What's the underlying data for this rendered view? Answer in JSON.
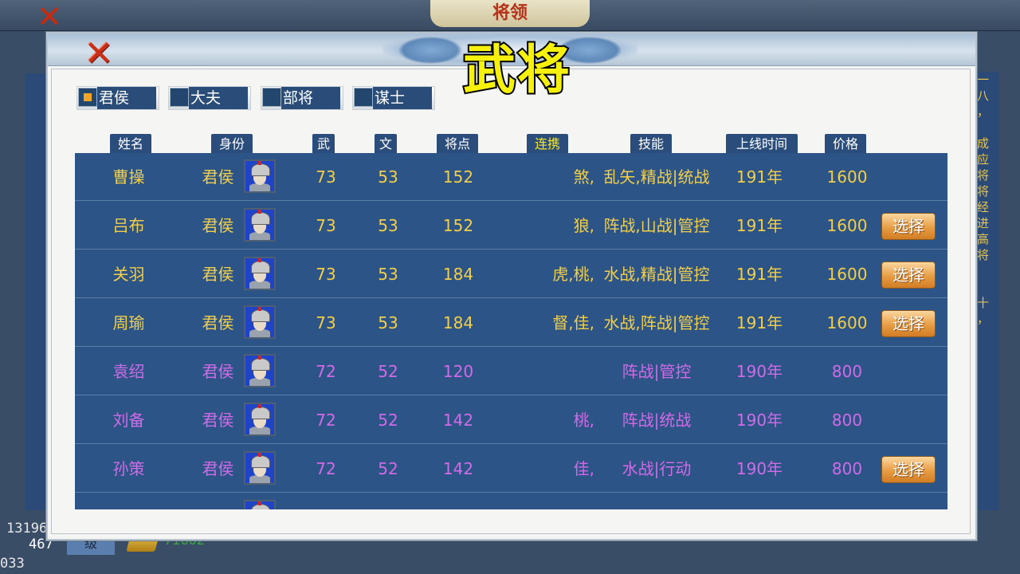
{
  "background": {
    "title": "将领",
    "num1": "13196",
    "num2": "467",
    "num3": "033",
    "level": "级",
    "gold": "71662",
    "right_text": [
      "一",
      "八",
      "，",
      "",
      "成",
      "应",
      "将",
      "将",
      "经",
      "进",
      "高",
      "将",
      "",
      "",
      "十",
      "，"
    ]
  },
  "dialog": {
    "close_glyph": "✕",
    "overlay_title": "武将",
    "filters": [
      {
        "label": "君侯",
        "checked": true
      },
      {
        "label": "大夫",
        "checked": false
      },
      {
        "label": "部将",
        "checked": false
      },
      {
        "label": "谋士",
        "checked": false
      }
    ],
    "columns": {
      "name": "姓名",
      "rank": "身份",
      "wu": "武",
      "wen": "文",
      "points": "将点",
      "combo": "连携",
      "skills": "技能",
      "online": "上线时间",
      "price": "价格"
    },
    "select_label": "选择",
    "rows": [
      {
        "name": "曹操",
        "rank": "君侯",
        "wu": "73",
        "wen": "53",
        "points": "152",
        "combo": "煞,",
        "skills": "乱矢,精战|统战",
        "online": "191年",
        "price": "1600",
        "selectable": false,
        "tier": "gold"
      },
      {
        "name": "吕布",
        "rank": "君侯",
        "wu": "73",
        "wen": "53",
        "points": "152",
        "combo": "狼,",
        "skills": "阵战,山战|管控",
        "online": "191年",
        "price": "1600",
        "selectable": true,
        "tier": "gold"
      },
      {
        "name": "关羽",
        "rank": "君侯",
        "wu": "73",
        "wen": "53",
        "points": "184",
        "combo": "虎,桃,",
        "skills": "水战,精战|管控",
        "online": "191年",
        "price": "1600",
        "selectable": true,
        "tier": "gold"
      },
      {
        "name": "周瑜",
        "rank": "君侯",
        "wu": "73",
        "wen": "53",
        "points": "184",
        "combo": "督,佳,",
        "skills": "水战,阵战|管控",
        "online": "191年",
        "price": "1600",
        "selectable": true,
        "tier": "gold"
      },
      {
        "name": "袁绍",
        "rank": "君侯",
        "wu": "72",
        "wen": "52",
        "points": "120",
        "combo": "",
        "skills": "阵战|管控",
        "online": "190年",
        "price": "800",
        "selectable": false,
        "tier": "purple"
      },
      {
        "name": "刘备",
        "rank": "君侯",
        "wu": "72",
        "wen": "52",
        "points": "142",
        "combo": "桃,",
        "skills": "阵战|统战",
        "online": "190年",
        "price": "800",
        "selectable": false,
        "tier": "purple"
      },
      {
        "name": "孙策",
        "rank": "君侯",
        "wu": "72",
        "wen": "52",
        "points": "142",
        "combo": "佳,",
        "skills": "水战|行动",
        "online": "190年",
        "price": "800",
        "selectable": true,
        "tier": "purple"
      }
    ]
  }
}
